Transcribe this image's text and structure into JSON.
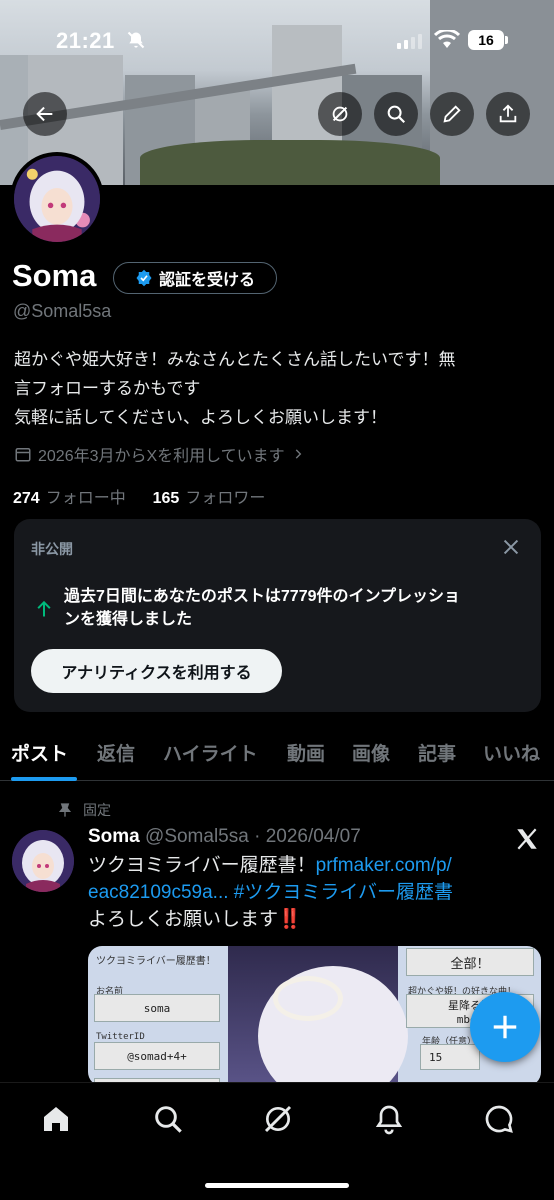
{
  "status_bar": {
    "time": "21:21",
    "battery": "16"
  },
  "profile": {
    "name": "Soma",
    "verify_label": "認証を受ける",
    "handle": "@Somal5sa",
    "bio_lines": [
      "超かぐや姫大好き！みなさんとたくさん話したいです！無",
      "言フォローするかもです",
      "気軽に話してください、よろしくお願いします！"
    ],
    "joined": "2026年3月からXを利用しています",
    "following_count": "274",
    "following_label": "フォロー中",
    "followers_count": "165",
    "followers_label": "フォロワー"
  },
  "card": {
    "label": "非公開",
    "text_line1": "過去7日間にあなたのポストは7779件のインプレッショ",
    "text_line2": "ンを獲得しました",
    "button": "アナリティクスを利用する"
  },
  "tabs": [
    {
      "label": "ポスト"
    },
    {
      "label": "返信"
    },
    {
      "label": "ハイライト"
    },
    {
      "label": "動画"
    },
    {
      "label": "画像"
    },
    {
      "label": "記事"
    },
    {
      "label": "いいね"
    }
  ],
  "pinned_post": {
    "pinned_label": "固定",
    "author": "Soma",
    "handle_date": "@Somal5sa · 2026/04/07",
    "text_line1": "ツクヨミライバー履歴書！",
    "link1": "prfmaker.com/p/",
    "link2": "eac82109c59a...",
    "hashtag": "#ツクヨミライバー履歴書",
    "text_line3": "よろしくお願いします",
    "emoji": "‼️",
    "image": {
      "title": "ツクヨミライバー履歴書！",
      "name_label": "お名前",
      "name_value": "soma",
      "twitter_label": "TwitterID",
      "twitter_value": "@somad+4+",
      "all_label": "全部！",
      "likes_label": "超かぐや姫！の好きな曲！",
      "song_line1": "星降る海",
      "song_line2": "mber",
      "age_label": "年齢（任意）",
      "age_value": "15"
    }
  },
  "colors": {
    "accent": "#1d9bf0",
    "background": "#000000",
    "muted": "#71767b"
  },
  "icons": {
    "nav": [
      "home-icon",
      "search-icon",
      "grok-icon",
      "notifications-icon",
      "messages-icon"
    ],
    "banner": [
      "back-icon",
      "grok-icon",
      "search-icon",
      "edit-icon",
      "share-icon"
    ]
  }
}
